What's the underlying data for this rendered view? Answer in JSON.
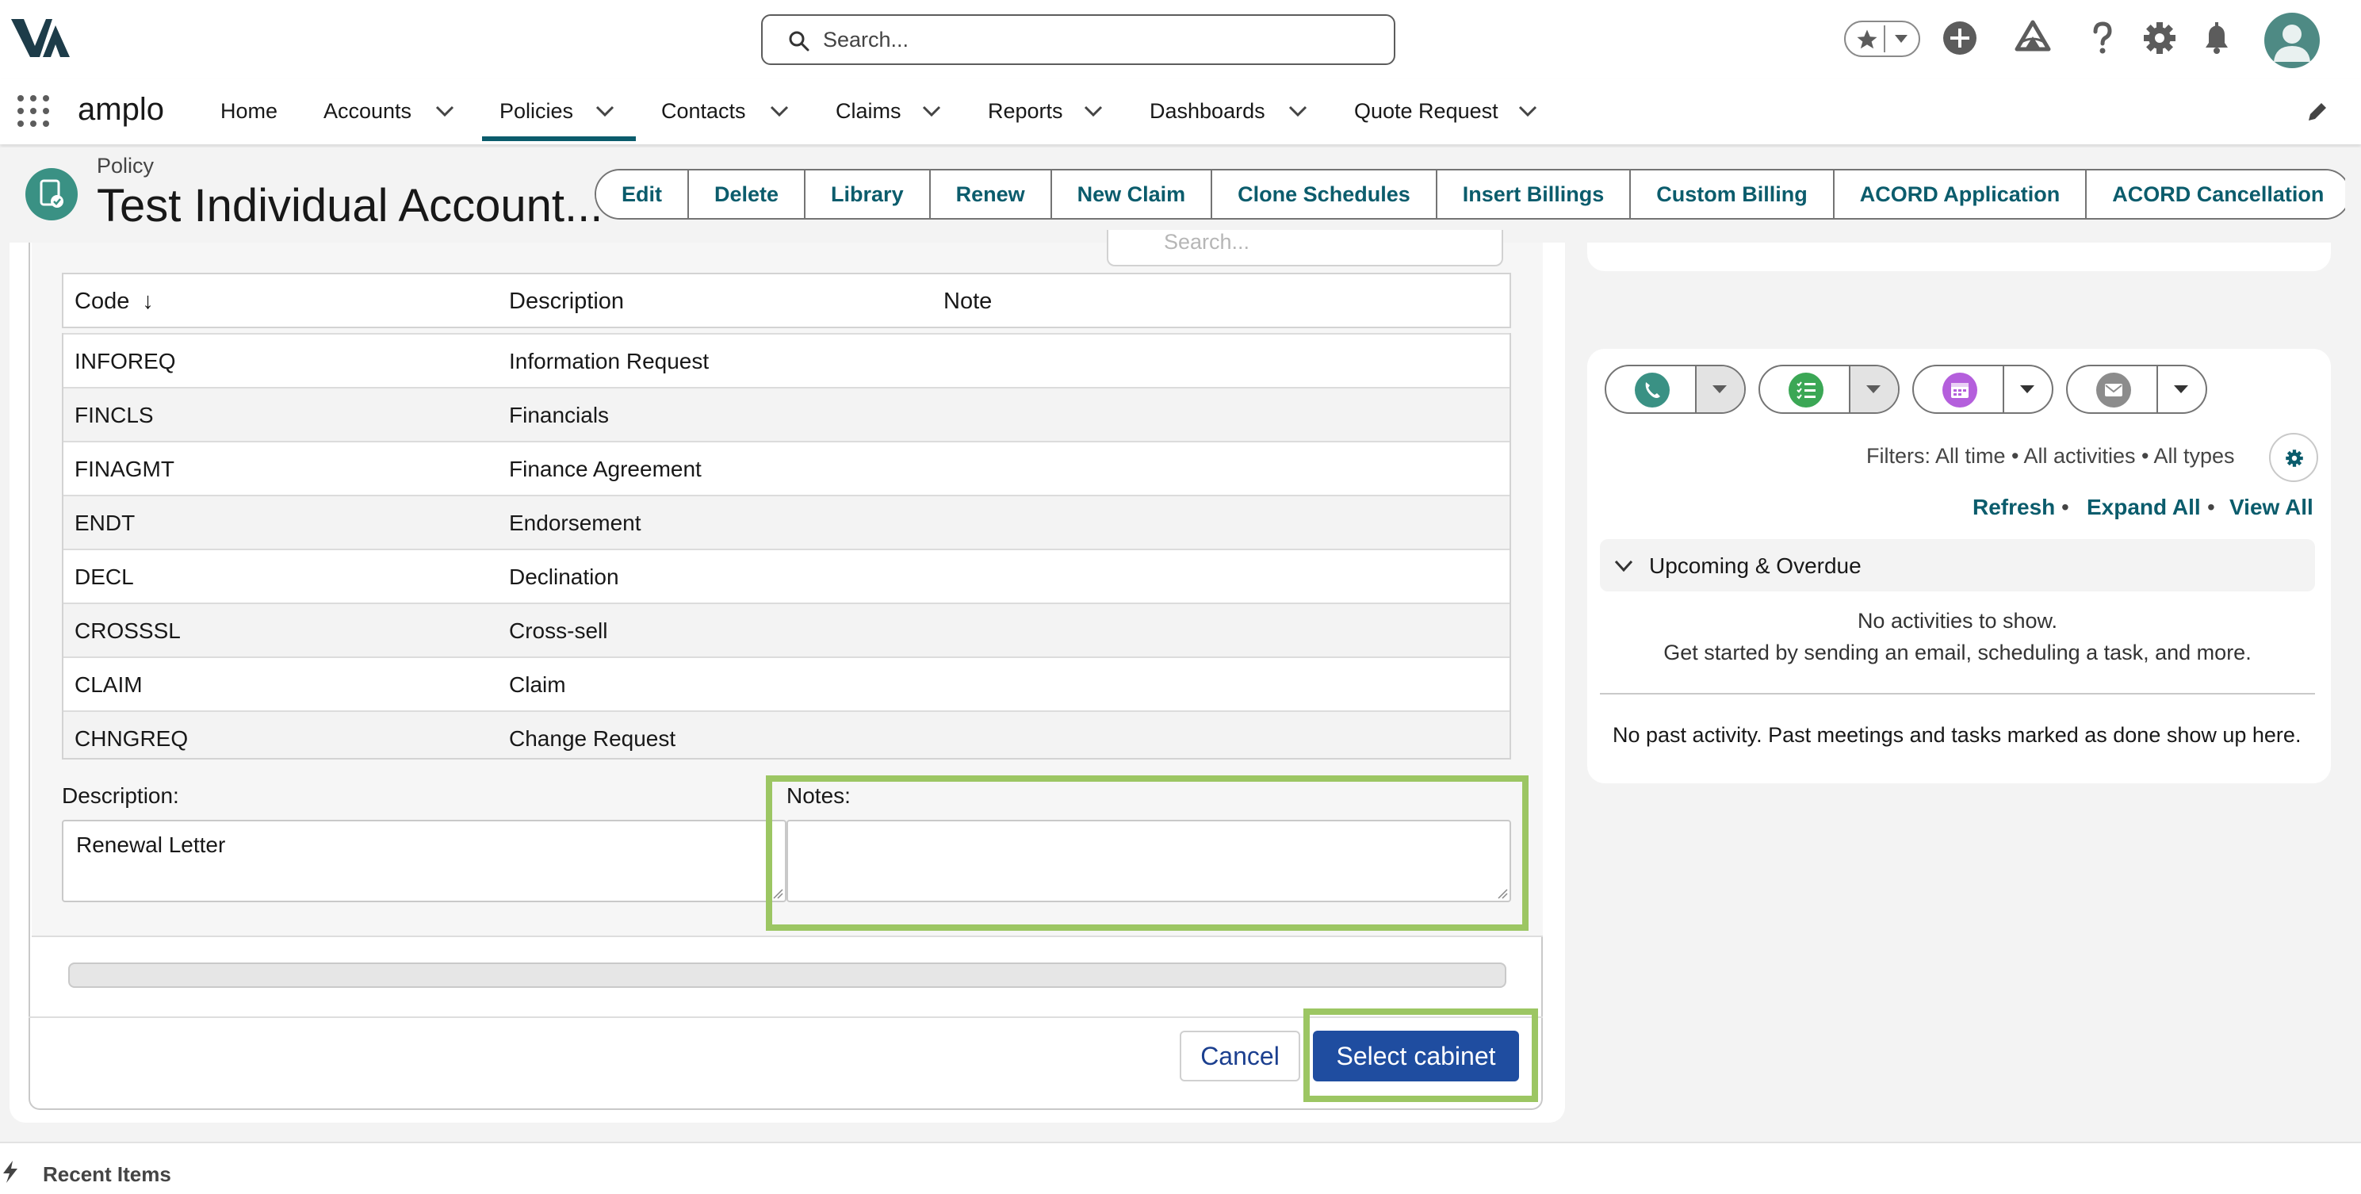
{
  "header": {
    "search_placeholder": "Search..."
  },
  "nav": {
    "app_name": "amplo",
    "items": [
      {
        "label": "Home",
        "has_menu": false
      },
      {
        "label": "Accounts",
        "has_menu": true
      },
      {
        "label": "Policies",
        "has_menu": true,
        "active": true
      },
      {
        "label": "Contacts",
        "has_menu": true
      },
      {
        "label": "Claims",
        "has_menu": true
      },
      {
        "label": "Reports",
        "has_menu": true
      },
      {
        "label": "Dashboards",
        "has_menu": true
      },
      {
        "label": "Quote Request",
        "has_menu": true
      }
    ]
  },
  "record": {
    "object_type": "Policy",
    "title": "Test Individual Account...",
    "actions": [
      "Edit",
      "Delete",
      "Library",
      "Renew",
      "New Claim",
      "Clone Schedules",
      "Insert Billings",
      "Custom Billing",
      "ACORD Application",
      "ACORD Cancellation"
    ]
  },
  "modal": {
    "search_placeholder": "Search...",
    "columns": {
      "code": "Code",
      "description": "Description",
      "note": "Note",
      "sort_indicator": "↓"
    },
    "rows": [
      {
        "code": "INFOREQ",
        "description": "Information Request",
        "note": ""
      },
      {
        "code": "FINCLS",
        "description": "Financials",
        "note": ""
      },
      {
        "code": "FINAGMT",
        "description": "Finance Agreement",
        "note": ""
      },
      {
        "code": "ENDT",
        "description": "Endorsement",
        "note": ""
      },
      {
        "code": "DECL",
        "description": "Declination",
        "note": ""
      },
      {
        "code": "CROSSSL",
        "description": "Cross-sell",
        "note": ""
      },
      {
        "code": "CLAIM",
        "description": "Claim",
        "note": ""
      },
      {
        "code": "CHNGREQ",
        "description": "Change Request",
        "note": ""
      }
    ],
    "description_label": "Description:",
    "description_value": "Renewal Letter",
    "notes_label": "Notes:",
    "notes_value": "",
    "cancel_label": "Cancel",
    "select_label": "Select cabinet"
  },
  "activity": {
    "filters_text": "Filters: All time • All activities • All types",
    "refresh": "Refresh",
    "expand_all": "Expand All",
    "view_all": "View All",
    "separator": "•",
    "upcoming_label": "Upcoming & Overdue",
    "no_activities": "No activities to show.",
    "get_started": "Get started by sending an email, scheduling a task, and more.",
    "past_activity": "No past activity. Past meetings and tasks marked as done show up here."
  },
  "utility": {
    "recent_items": "Recent Items"
  },
  "colors": {
    "brand_teal": "#0b5c6c",
    "primary_button": "#1f4da0",
    "highlight_green": "#9cc663",
    "call_icon": "#3a9184",
    "task_icon": "#3ba755",
    "event_icon": "#b45fdc",
    "email_icon": "#8c8c8c"
  },
  "icons": [
    "logo-icon",
    "search-icon",
    "favorites-icon",
    "add-icon",
    "trailhead-icon",
    "help-icon",
    "settings-icon",
    "notifications-icon",
    "avatar-icon",
    "app-launcher-icon",
    "edit-nav-icon",
    "policy-object-icon",
    "log-call-icon",
    "new-task-icon",
    "new-event-icon",
    "email-icon",
    "filter-settings-icon",
    "bolt-icon"
  ]
}
